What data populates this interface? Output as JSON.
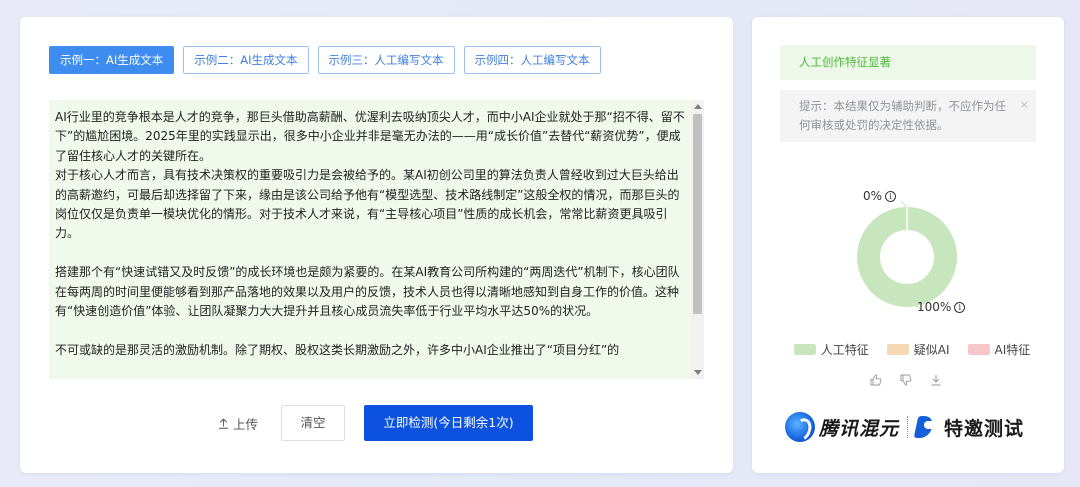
{
  "tabs": [
    {
      "label": "示例一：AI生成文本",
      "active": true
    },
    {
      "label": "示例二：AI生成文本",
      "active": false
    },
    {
      "label": "示例三：人工编写文本",
      "active": false
    },
    {
      "label": "示例四：人工编写文本",
      "active": false
    }
  ],
  "text": {
    "paragraphs": [
      "AI行业里的竞争根本是人才的竞争，那巨头借助高薪酬、优渥利去吸纳顶尖人才，而中小AI企业就处于那“招不得、留不下”的尴尬困境。2025年里的实践显示出，很多中小企业并非是毫无办法的——用“成长价值”去替代“薪资优势”，便成了留住核心人才的关键所在。",
      "对于核心人才而言，具有技术决策权的重要吸引力是会被给予的。某AI初创公司里的算法负责人曾经收到过大巨头给出的高薪邀约，可最后却选择留了下来，缘由是该公司给予他有“模型选型、技术路线制定”这般全权的情况，而那巨头的岗位仅仅是负责单一模块优化的情形。对于技术人才来说，有“主导核心项目”性质的成长机会，常常比薪资更具吸引力。",
      "",
      "搭建那个有“快速试错又及时反馈”的成长环境也是颇为紧要的。在某AI教育公司所构建的“两周迭代”机制下，核心团队在每两周的时间里便能够看到那产品落地的效果以及用户的反馈，技术人员也得以清晰地感知到自身工作的价值。这种有“快速创造价值”体验、让团队凝聚力大大提升并且核心成员流失率低于行业平均水平达50%的状况。",
      "",
      "不可或缺的是那灵活的激励机制。除了期权、股权这类长期激励之外，许多中小AI企业推出了“项目分红”的"
    ]
  },
  "actions": {
    "upload_label": "上传",
    "clear_label": "清空",
    "detect_label": "立即检测(今日剩余1次)"
  },
  "result": {
    "banner": "人工创作特征显著",
    "notice": "提示：本结果仅为辅助判断，不应作为任何审核或处罚的决定性依据。",
    "notice_close": "×"
  },
  "chart_data": {
    "type": "pie",
    "donut": true,
    "categories": [
      "人工特征",
      "疑似AI",
      "AI特征"
    ],
    "values": [
      100,
      0,
      0
    ],
    "labels": [
      "100%",
      "0%"
    ],
    "colors": [
      "#c8e6bd",
      "#f5d9b3",
      "#f6c6c9"
    ],
    "legend_placement": "bottom"
  },
  "feedback": {
    "like_icon": "thumbs-up-icon",
    "dislike_icon": "thumbs-down-icon",
    "download_icon": "download-icon"
  },
  "brand": {
    "name": "腾讯混元",
    "invite": "特邀测试"
  }
}
